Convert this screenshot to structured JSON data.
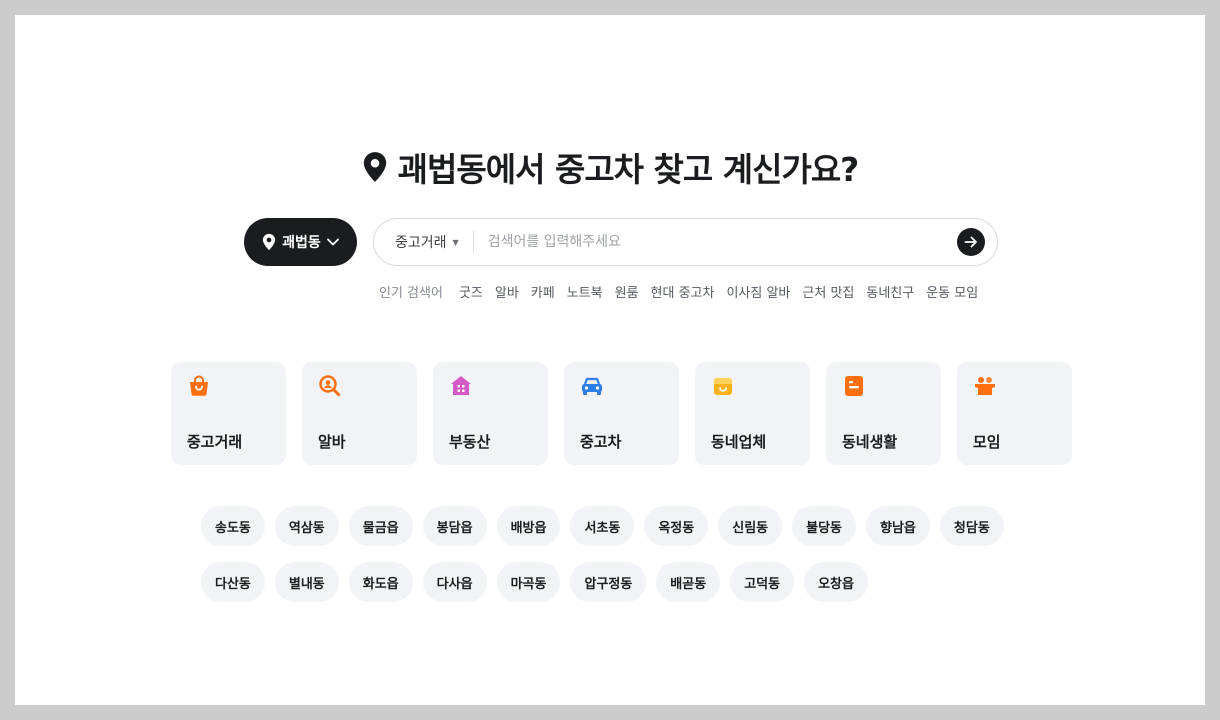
{
  "headline": {
    "text": "괘법동에서 중고차 찾고 계신가요?"
  },
  "location": {
    "label": "괘법동"
  },
  "search": {
    "category": "중고거래",
    "placeholder": "검색어를 입력해주세요"
  },
  "popular": {
    "label": "인기 검색어",
    "keywords": [
      "굿즈",
      "알바",
      "카페",
      "노트북",
      "원룸",
      "현대 중고차",
      "이사짐 알바",
      "근처 맛집",
      "동네친구",
      "운동 모임"
    ]
  },
  "categories": [
    {
      "label": "중고거래",
      "icon": "shopping-bag-icon",
      "color": "#ff6f0f"
    },
    {
      "label": "알바",
      "icon": "magnifier-person-icon",
      "color": "#ff6f0f"
    },
    {
      "label": "부동산",
      "icon": "house-icon",
      "color": "#d65ac6"
    },
    {
      "label": "중고차",
      "icon": "car-icon",
      "color": "#2c7de6"
    },
    {
      "label": "동네업체",
      "icon": "store-icon",
      "color": "#ffb21c"
    },
    {
      "label": "동네생활",
      "icon": "document-icon",
      "color": "#ff6f0f"
    },
    {
      "label": "모임",
      "icon": "group-icon",
      "color": "#ff6f0f"
    }
  ],
  "neighborhoods": [
    "송도동",
    "역삼동",
    "물금읍",
    "봉담읍",
    "배방읍",
    "서초동",
    "옥정동",
    "신림동",
    "불당동",
    "향남읍",
    "청담동",
    "다산동",
    "별내동",
    "화도읍",
    "다사읍",
    "마곡동",
    "압구정동",
    "배곧동",
    "고덕동",
    "오창읍"
  ]
}
